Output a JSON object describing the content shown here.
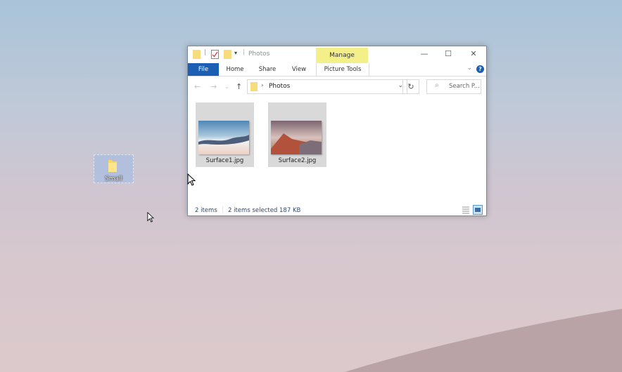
{
  "desktop": {
    "icons": [
      {
        "label": "Small"
      }
    ]
  },
  "window": {
    "title": "Photos",
    "contextual_tab_group": "Manage",
    "quick_access": [
      "folder-icon",
      "properties-icon",
      "new-folder-icon",
      "customize-dropdown"
    ],
    "controls": {
      "minimize": "—",
      "maximize": "☐",
      "close": "✕"
    },
    "ribbon": {
      "tabs": [
        {
          "label": "File"
        },
        {
          "label": "Home"
        },
        {
          "label": "Share"
        },
        {
          "label": "View"
        },
        {
          "label": "Picture Tools"
        }
      ],
      "collapse": "⌄",
      "help": "?"
    },
    "nav": {
      "back": "←",
      "forward": "→",
      "recent": "⌄",
      "up": "↑",
      "breadcrumb": [
        "Photos"
      ],
      "breadcrumb_sep": "›",
      "address_dropdown": "⌄",
      "refresh": "↻",
      "search_placeholder": "Search P...",
      "search_icon": "⌕"
    },
    "files": [
      {
        "name": "Surface1.jpg",
        "selected": true
      },
      {
        "name": "Surface2.jpg",
        "selected": true
      }
    ],
    "status": {
      "item_count": "2 items",
      "selection": "2 items selected  187 KB"
    },
    "views": {
      "active": "large-icons"
    }
  }
}
